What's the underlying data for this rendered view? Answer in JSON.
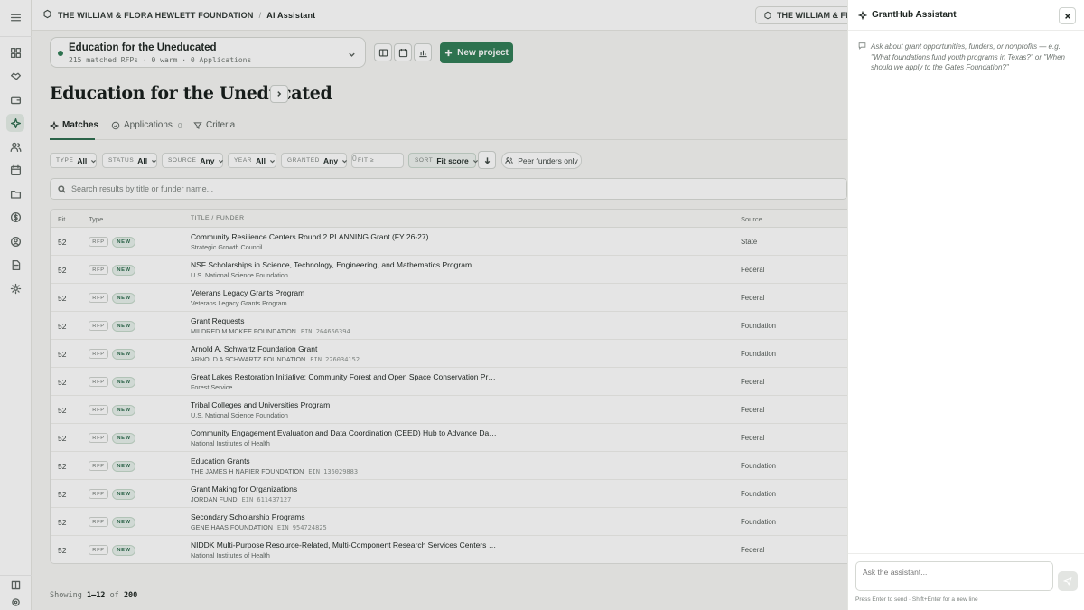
{
  "breadcrumb": {
    "org": "THE WILLIAM & FLORA HEWLETT FOUNDATION",
    "page": "AI Assistant"
  },
  "org_selector": {
    "label": "THE WILLIAM & FL…"
  },
  "project": {
    "name": "Education for the Uneducated",
    "meta": "215 matched RFPs · 0 warm · 0 Applications",
    "new_project_label": "New project"
  },
  "page_title": "Education for the Uneducated",
  "tabs": [
    {
      "label": "Matches",
      "count": ""
    },
    {
      "label": "Applications",
      "count": "0"
    },
    {
      "label": "Criteria",
      "count": ""
    }
  ],
  "filters": [
    {
      "label": "TYPE",
      "value": "All"
    },
    {
      "label": "STATUS",
      "value": "All"
    },
    {
      "label": "SOURCE",
      "value": "Any"
    },
    {
      "label": "YEAR",
      "value": "All"
    },
    {
      "label": "GRANTED",
      "value": "Any"
    },
    {
      "label": "FIT ≥",
      "value": "0"
    },
    {
      "label": "SORT",
      "value": "Fit score"
    }
  ],
  "peer_label": "Peer funders only",
  "search": {
    "placeholder": "Search results by title or funder name..."
  },
  "table": {
    "headers": {
      "fit": "Fit",
      "type": "Type",
      "title": "TITLE / FUNDER",
      "source": "Source"
    },
    "rows": [
      {
        "fit": "52",
        "type": "RFP",
        "status": "NEW",
        "title": "Community Resilience Centers Round 2 PLANNING Grant (FY 26-27)",
        "funder": "Strategic Growth Council",
        "ein": "",
        "source": "State"
      },
      {
        "fit": "52",
        "type": "RFP",
        "status": "NEW",
        "title": "NSF Scholarships in Science, Technology, Engineering, and Mathematics Program",
        "funder": "U.S. National Science Foundation",
        "ein": "",
        "source": "Federal"
      },
      {
        "fit": "52",
        "type": "RFP",
        "status": "NEW",
        "title": "Veterans Legacy Grants Program",
        "funder": "Veterans Legacy Grants Program",
        "ein": "",
        "source": "Federal"
      },
      {
        "fit": "52",
        "type": "RFP",
        "status": "NEW",
        "title": "Grant Requests",
        "funder": "MILDRED M MCKEE FOUNDATION",
        "ein": "EIN 264656394",
        "source": "Foundation"
      },
      {
        "fit": "52",
        "type": "RFP",
        "status": "NEW",
        "title": "Arnold A. Schwartz Foundation Grant",
        "funder": "ARNOLD A SCHWARTZ FOUNDATION",
        "ein": "EIN 226034152",
        "source": "Foundation"
      },
      {
        "fit": "52",
        "type": "RFP",
        "status": "NEW",
        "title": "Great Lakes Restoration Initiative: Community Forest and Open Space Conservation Progr…",
        "funder": "Forest Service",
        "ein": "",
        "source": "Federal"
      },
      {
        "fit": "52",
        "type": "RFP",
        "status": "NEW",
        "title": "Tribal Colleges and Universities Program",
        "funder": "U.S. National Science Foundation",
        "ein": "",
        "source": "Federal"
      },
      {
        "fit": "52",
        "type": "RFP",
        "status": "NEW",
        "title": "Community Engagement Evaluation and Data Coordination (CEED) Hub to Advance Data a…",
        "funder": "National Institutes of Health",
        "ein": "",
        "source": "Federal"
      },
      {
        "fit": "52",
        "type": "RFP",
        "status": "NEW",
        "title": "Education Grants",
        "funder": "THE JAMES H NAPIER FOUNDATION",
        "ein": "EIN 136029883",
        "source": "Foundation"
      },
      {
        "fit": "52",
        "type": "RFP",
        "status": "NEW",
        "title": "Grant Making for Organizations",
        "funder": "JORDAN FUND",
        "ein": "EIN 611437127",
        "source": "Foundation"
      },
      {
        "fit": "52",
        "type": "RFP",
        "status": "NEW",
        "title": "Secondary Scholarship Programs",
        "funder": "GENE HAAS FOUNDATION",
        "ein": "EIN 954724825",
        "source": "Foundation"
      },
      {
        "fit": "52",
        "type": "RFP",
        "status": "NEW",
        "title": "NIDDK Multi-Purpose Resource-Related, Multi-Component Research Services Centers Co…",
        "funder": "National Institutes of Health",
        "ein": "",
        "source": "Federal"
      }
    ]
  },
  "pagination": {
    "prefix": "Showing",
    "range": "1–12",
    "of": "of",
    "total": "200"
  },
  "assistant": {
    "title": "GrantHub Assistant",
    "hint": "Ask about grant opportunities, funders, or nonprofits — e.g. \"What foundations fund youth programs in Texas?\" or \"When should we apply to the Gates Foundation?\"",
    "input_placeholder": "Ask the assistant...",
    "footnote": "Press Enter to send · Shift+Enter for a new line"
  }
}
